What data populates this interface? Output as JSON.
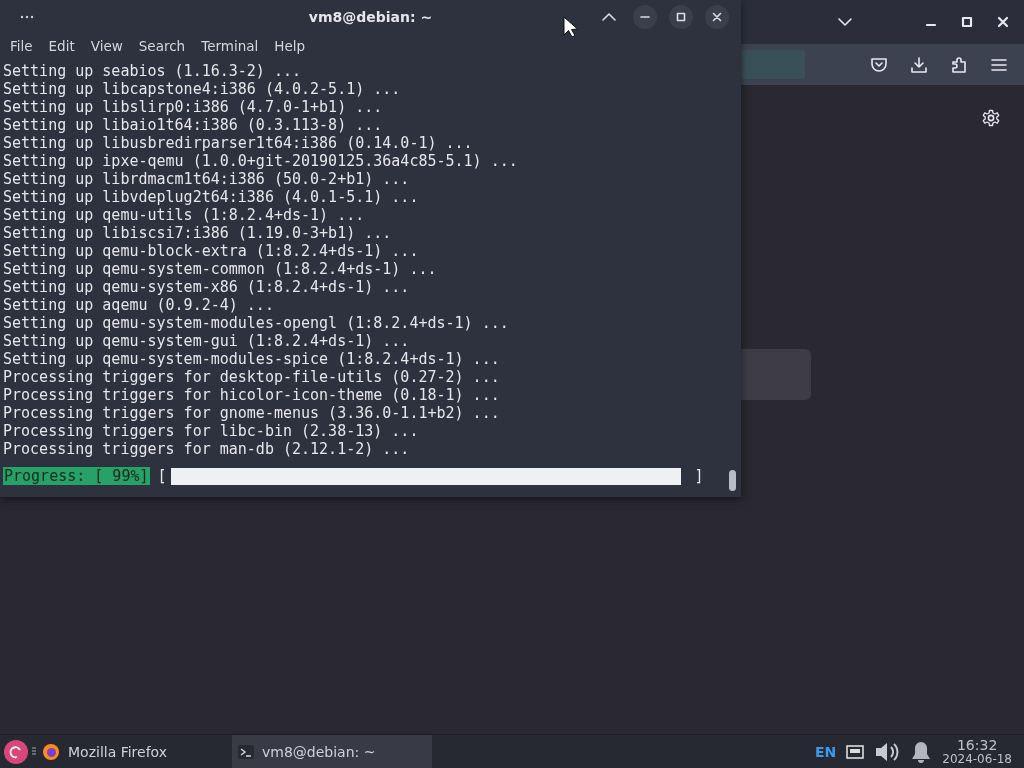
{
  "terminal": {
    "title": "vm8@debian: ~",
    "menu": [
      "File",
      "Edit",
      "View",
      "Search",
      "Terminal",
      "Help"
    ],
    "lines": [
      "Setting up seabios (1.16.3-2) ...",
      "Setting up libcapstone4:i386 (4.0.2-5.1) ...",
      "Setting up libslirp0:i386 (4.7.0-1+b1) ...",
      "Setting up libaio1t64:i386 (0.3.113-8) ...",
      "Setting up libusbredirparser1t64:i386 (0.14.0-1) ...",
      "Setting up ipxe-qemu (1.0.0+git-20190125.36a4c85-5.1) ...",
      "Setting up librdmacm1t64:i386 (50.0-2+b1) ...",
      "Setting up libvdeplug2t64:i386 (4.0.1-5.1) ...",
      "Setting up qemu-utils (1:8.2.4+ds-1) ...",
      "Setting up libiscsi7:i386 (1.19.0-3+b1) ...",
      "Setting up qemu-block-extra (1:8.2.4+ds-1) ...",
      "Setting up qemu-system-common (1:8.2.4+ds-1) ...",
      "Setting up qemu-system-x86 (1:8.2.4+ds-1) ...",
      "Setting up aqemu (0.9.2-4) ...",
      "Setting up qemu-system-modules-opengl (1:8.2.4+ds-1) ...",
      "Setting up qemu-system-gui (1:8.2.4+ds-1) ...",
      "Setting up qemu-system-modules-spice (1:8.2.4+ds-1) ...",
      "Processing triggers for desktop-file-utils (0.27-2) ...",
      "Processing triggers for hicolor-icon-theme (0.18-1) ...",
      "Processing triggers for gnome-menus (3.36.0-1.1+b2) ...",
      "Processing triggers for libc-bin (2.38-13) ...",
      "Processing triggers for man-db (2.12.1-2) ..."
    ],
    "progress": {
      "label": "Progress: [ 99%]",
      "open": "[",
      "close": "]",
      "level": 0.99
    }
  },
  "taskbar": {
    "items": [
      {
        "kind": "firefox",
        "label": "Mozilla Firefox",
        "selected": false
      },
      {
        "kind": "terminal",
        "label": "vm8@debian: ~",
        "selected": true
      }
    ],
    "language": "EN",
    "time": "16:32",
    "date": "2024-06-18"
  }
}
